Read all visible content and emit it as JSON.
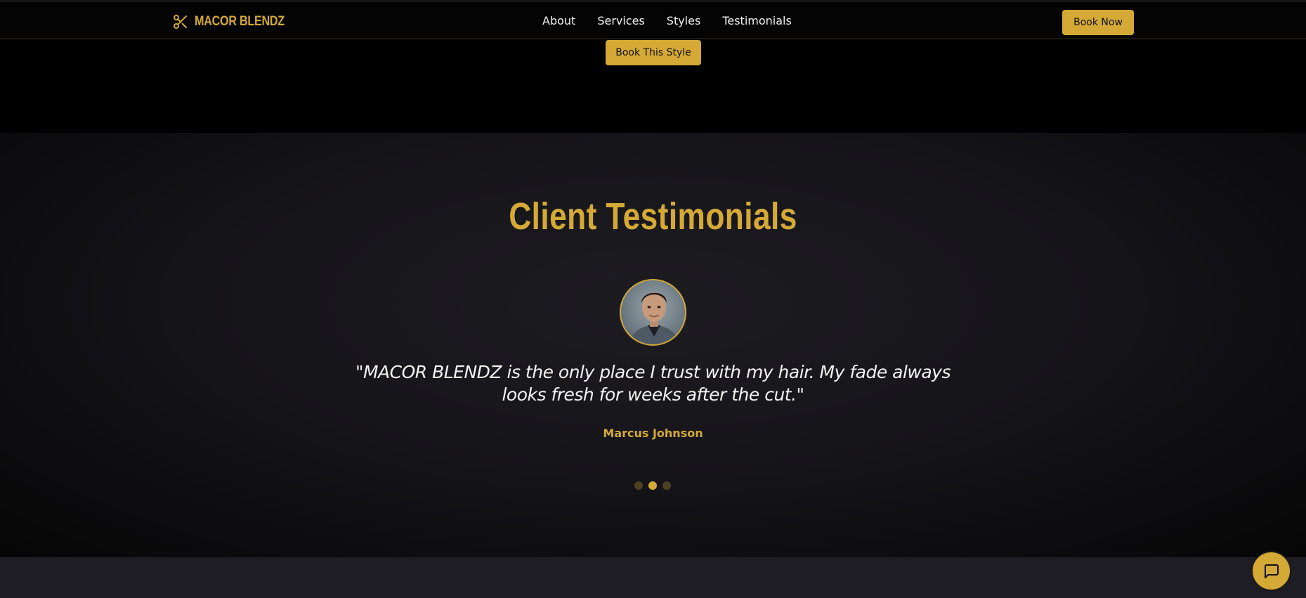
{
  "header": {
    "brand": "MACOR BLENDZ",
    "brand_icon": "scissors-icon",
    "nav": [
      "About",
      "Services",
      "Styles",
      "Testimonials"
    ],
    "cta": "Book Now"
  },
  "styles_section": {
    "book_button": "Book This Style"
  },
  "testimonials": {
    "title": "Client Testimonials",
    "quote": "\"MACOR BLENDZ is the only place I trust with my hair. My fade always looks fresh for weeks after the cut.\"",
    "author": "Marcus Johnson",
    "active_slide": 2,
    "slide_count": 3
  },
  "chat": {
    "icon": "chat-bubble-icon"
  },
  "colors": {
    "accent": "#d4a935",
    "background": "#000000",
    "section_bg": "#16151a"
  }
}
